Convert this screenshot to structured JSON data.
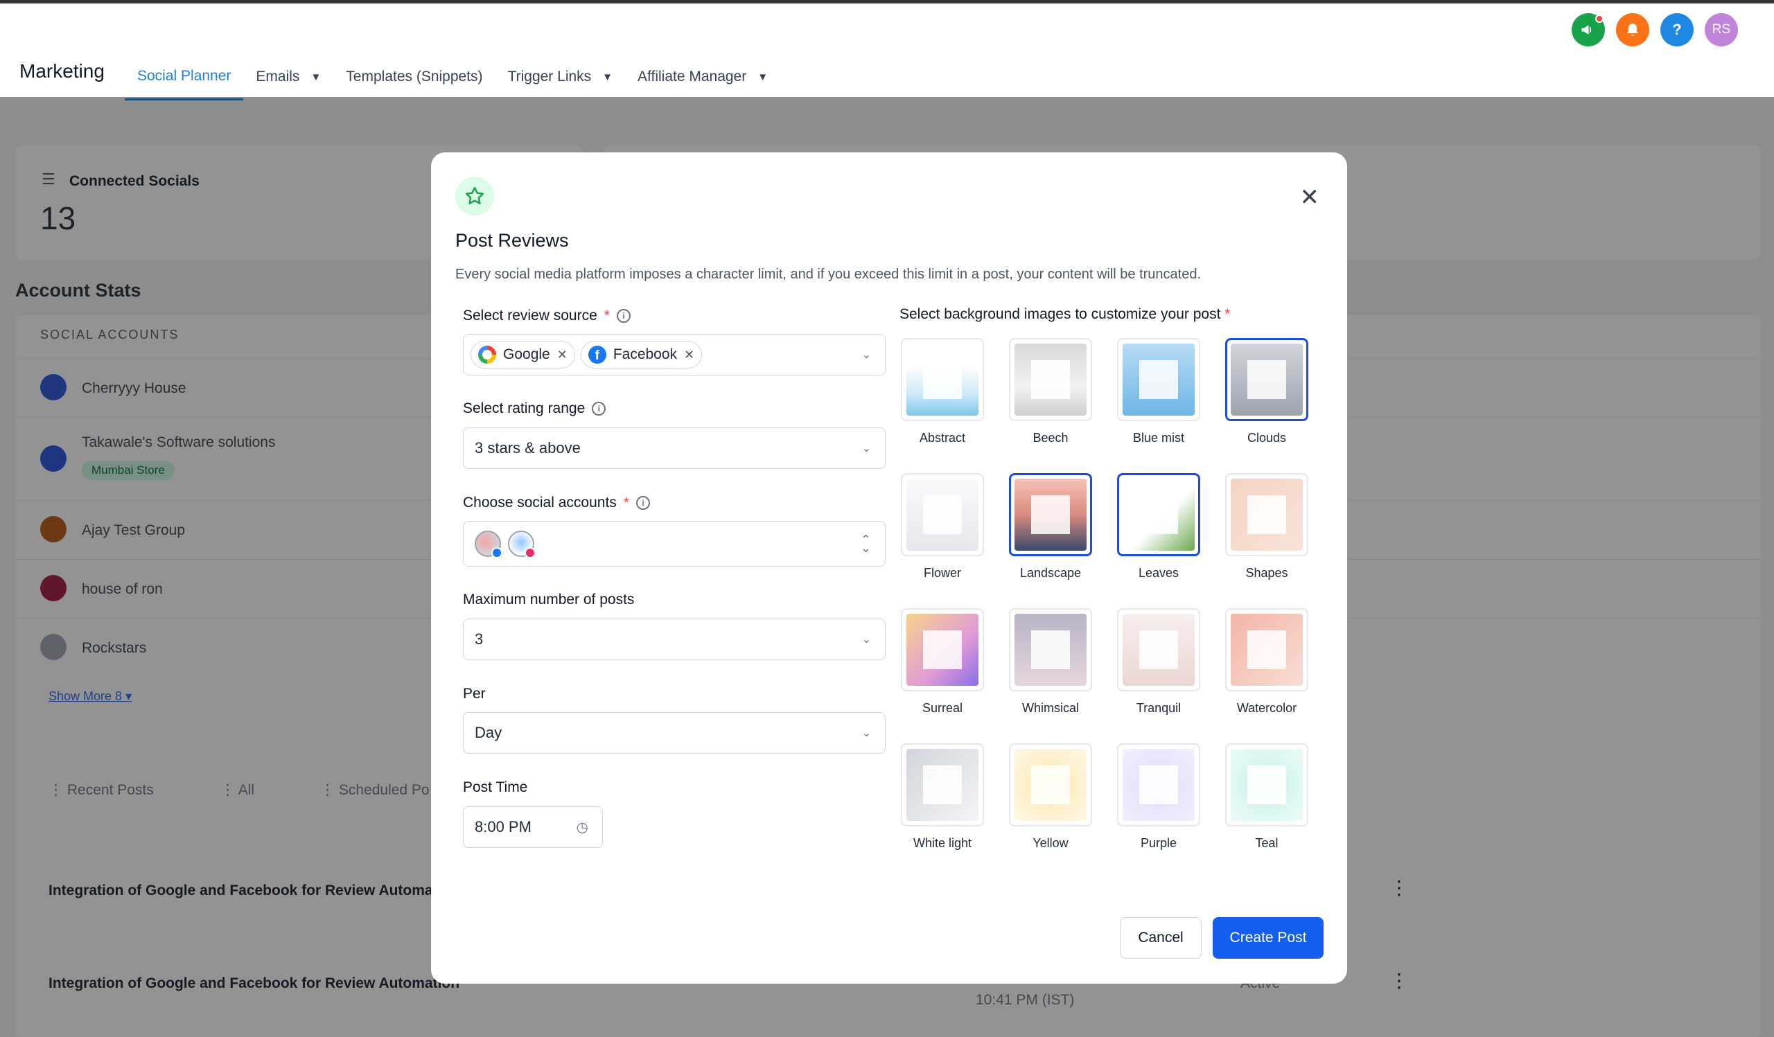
{
  "topbar": {
    "brand": "Marketing",
    "nav": [
      {
        "label": "Social Planner",
        "active": true,
        "dropdown": false
      },
      {
        "label": "Emails",
        "active": false,
        "dropdown": true
      },
      {
        "label": "Templates (Snippets)",
        "active": false,
        "dropdown": false
      },
      {
        "label": "Trigger Links",
        "active": false,
        "dropdown": true
      },
      {
        "label": "Affiliate Manager",
        "active": false,
        "dropdown": true
      }
    ],
    "avatar_initials": "RS",
    "icons": [
      "megaphone-icon",
      "bell-icon",
      "help-icon"
    ],
    "colors": {
      "megaphone": "#16a34a",
      "bell": "#f97316",
      "help": "#1e88e5",
      "avatar": "#c084d8"
    }
  },
  "background": {
    "connected_socials_label": "Connected Socials",
    "connected_socials_count": "13",
    "account_stats_title": "Account Stats",
    "social_accounts_header": "SOCIAL ACCOUNTS",
    "accounts": [
      {
        "name": "Cherryyy House",
        "tag": ""
      },
      {
        "name": "Takawale's Software solutions",
        "tag": "Mumbai Store"
      },
      {
        "name": "Ajay Test Group",
        "tag": ""
      },
      {
        "name": "house of ron",
        "tag": ""
      },
      {
        "name": "Rockstars",
        "tag": ""
      }
    ],
    "show_more": "Show More 8",
    "post_tabs": [
      "Recent Posts",
      "All",
      "Scheduled Po"
    ],
    "post_rows": [
      {
        "title": "Integration of Google and Facebook for Review Automat"
      },
      {
        "title": "Integration of Google and Facebook for Review Automation",
        "time": "10:41 PM (IST)",
        "status": "Active"
      }
    ]
  },
  "modal": {
    "title": "Post Reviews",
    "subtitle": "Every social media platform imposes a character limit, and if you exceed this limit in a post, your content will be truncated.",
    "review_source": {
      "label": "Select review source",
      "chips": [
        {
          "name": "Google",
          "icon": "google-icon"
        },
        {
          "name": "Facebook",
          "icon": "facebook-icon"
        }
      ]
    },
    "rating_range": {
      "label": "Select rating range",
      "value": "3 stars & above"
    },
    "social_accounts": {
      "label": "Choose social accounts"
    },
    "max_posts": {
      "label": "Maximum number of posts",
      "value": "3"
    },
    "per": {
      "label": "Per",
      "value": "Day"
    },
    "post_time": {
      "label": "Post Time",
      "value": "8:00 PM"
    },
    "backgrounds_label": "Select background images to customize your post",
    "backgrounds": [
      {
        "name": "Abstract",
        "selected": false,
        "bg": "linear-gradient(#ffffff 30%, #cde9f7 70%, #7cc6ea)"
      },
      {
        "name": "Beech",
        "selected": false,
        "bg": "linear-gradient(#d9d9d9, #f2f2f2 60%, #cfcfcf)"
      },
      {
        "name": "Blue mist",
        "selected": false,
        "bg": "linear-gradient(#b7dcf5, #6fb5e6)"
      },
      {
        "name": "Clouds",
        "selected": true,
        "bg": "linear-gradient(#d1d5db, #9ca3af)"
      },
      {
        "name": "Flower",
        "selected": false,
        "bg": "linear-gradient(#f8fafc, #e5e7eb)"
      },
      {
        "name": "Landscape",
        "selected": true,
        "bg": "linear-gradient(#f7c1b6, #d98b7e 50%, #384a6b)"
      },
      {
        "name": "Leaves",
        "selected": true,
        "bg": "linear-gradient(135deg, #ffffff 55%, #6aa84f)"
      },
      {
        "name": "Shapes",
        "selected": false,
        "bg": "linear-gradient(135deg, #f5d3c4, #f6e3d8)"
      },
      {
        "name": "Surreal",
        "selected": false,
        "bg": "linear-gradient(135deg, #f6d28a, #e09ad6 60%, #8a6de8)"
      },
      {
        "name": "Whimsical",
        "selected": false,
        "bg": "linear-gradient(#b9b3c4, #e6d6df)"
      },
      {
        "name": "Tranquil",
        "selected": false,
        "bg": "linear-gradient(#f8eeee, #ead7d2)"
      },
      {
        "name": "Watercolor",
        "selected": false,
        "bg": "linear-gradient(135deg, #f3b4a7, #f8ddd4)"
      },
      {
        "name": "White light",
        "selected": false,
        "bg": "linear-gradient(135deg, #d1d5db, #f3f4f6)"
      },
      {
        "name": "Yellow",
        "selected": false,
        "bg": "radial-gradient(#fbe7b0, #fff8e6)"
      },
      {
        "name": "Purple",
        "selected": false,
        "bg": "radial-gradient(#e0dcfb, #f1effd)"
      },
      {
        "name": "Teal",
        "selected": false,
        "bg": "radial-gradient(#c8f1eb, #ecfbf8)"
      }
    ],
    "cancel": "Cancel",
    "create": "Create Post"
  }
}
